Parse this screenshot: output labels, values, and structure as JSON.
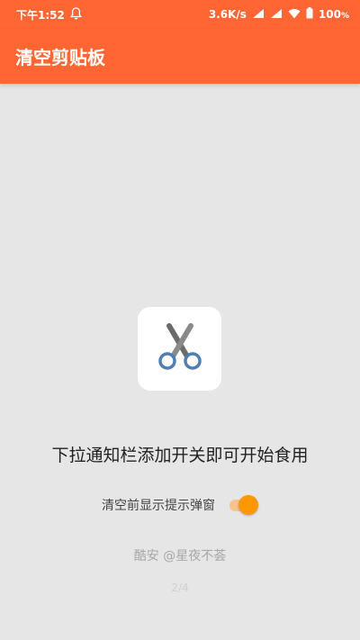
{
  "colors": {
    "accent": "#ff6633",
    "toggle_on": "#ff9800",
    "background": "#e6e6e6"
  },
  "status_bar": {
    "time": "下午1:52",
    "network_speed": "3.6K/s",
    "battery_percent": "100",
    "icons": [
      "notification-bell-icon",
      "signal-hd-icon",
      "signal-hd-icon",
      "wifi-icon",
      "battery-icon"
    ]
  },
  "app_bar": {
    "title": "清空剪贴板"
  },
  "main": {
    "app_icon": "scissors-icon",
    "headline": "下拉通知栏添加开关即可开始食用",
    "setting": {
      "label": "清空前显示提示弹窗",
      "enabled": true
    },
    "credit": "酷安 @星夜不荟",
    "page_indicator": "2/4"
  }
}
